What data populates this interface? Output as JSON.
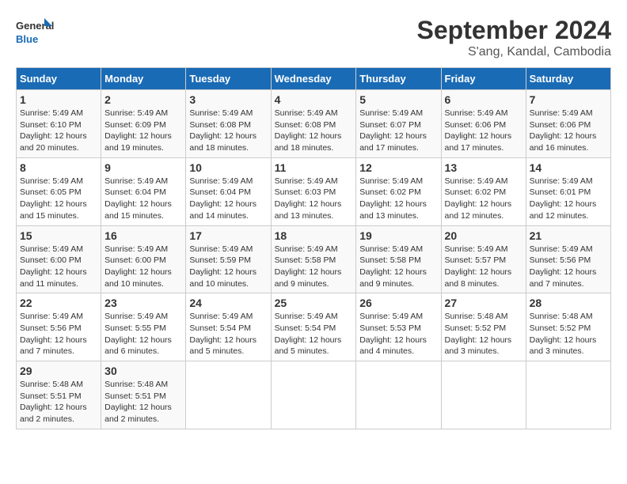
{
  "logo": {
    "text_general": "General",
    "text_blue": "Blue"
  },
  "header": {
    "month_year": "September 2024",
    "location": "S'ang, Kandal, Cambodia"
  },
  "weekdays": [
    "Sunday",
    "Monday",
    "Tuesday",
    "Wednesday",
    "Thursday",
    "Friday",
    "Saturday"
  ],
  "weeks": [
    [
      {
        "day": "1",
        "sunrise": "5:49 AM",
        "sunset": "6:10 PM",
        "daylight": "12 hours and 20 minutes."
      },
      {
        "day": "2",
        "sunrise": "5:49 AM",
        "sunset": "6:09 PM",
        "daylight": "12 hours and 19 minutes."
      },
      {
        "day": "3",
        "sunrise": "5:49 AM",
        "sunset": "6:08 PM",
        "daylight": "12 hours and 18 minutes."
      },
      {
        "day": "4",
        "sunrise": "5:49 AM",
        "sunset": "6:08 PM",
        "daylight": "12 hours and 18 minutes."
      },
      {
        "day": "5",
        "sunrise": "5:49 AM",
        "sunset": "6:07 PM",
        "daylight": "12 hours and 17 minutes."
      },
      {
        "day": "6",
        "sunrise": "5:49 AM",
        "sunset": "6:06 PM",
        "daylight": "12 hours and 17 minutes."
      },
      {
        "day": "7",
        "sunrise": "5:49 AM",
        "sunset": "6:06 PM",
        "daylight": "12 hours and 16 minutes."
      }
    ],
    [
      {
        "day": "8",
        "sunrise": "5:49 AM",
        "sunset": "6:05 PM",
        "daylight": "12 hours and 15 minutes."
      },
      {
        "day": "9",
        "sunrise": "5:49 AM",
        "sunset": "6:04 PM",
        "daylight": "12 hours and 15 minutes."
      },
      {
        "day": "10",
        "sunrise": "5:49 AM",
        "sunset": "6:04 PM",
        "daylight": "12 hours and 14 minutes."
      },
      {
        "day": "11",
        "sunrise": "5:49 AM",
        "sunset": "6:03 PM",
        "daylight": "12 hours and 13 minutes."
      },
      {
        "day": "12",
        "sunrise": "5:49 AM",
        "sunset": "6:02 PM",
        "daylight": "12 hours and 13 minutes."
      },
      {
        "day": "13",
        "sunrise": "5:49 AM",
        "sunset": "6:02 PM",
        "daylight": "12 hours and 12 minutes."
      },
      {
        "day": "14",
        "sunrise": "5:49 AM",
        "sunset": "6:01 PM",
        "daylight": "12 hours and 12 minutes."
      }
    ],
    [
      {
        "day": "15",
        "sunrise": "5:49 AM",
        "sunset": "6:00 PM",
        "daylight": "12 hours and 11 minutes."
      },
      {
        "day": "16",
        "sunrise": "5:49 AM",
        "sunset": "6:00 PM",
        "daylight": "12 hours and 10 minutes."
      },
      {
        "day": "17",
        "sunrise": "5:49 AM",
        "sunset": "5:59 PM",
        "daylight": "12 hours and 10 minutes."
      },
      {
        "day": "18",
        "sunrise": "5:49 AM",
        "sunset": "5:58 PM",
        "daylight": "12 hours and 9 minutes."
      },
      {
        "day": "19",
        "sunrise": "5:49 AM",
        "sunset": "5:58 PM",
        "daylight": "12 hours and 9 minutes."
      },
      {
        "day": "20",
        "sunrise": "5:49 AM",
        "sunset": "5:57 PM",
        "daylight": "12 hours and 8 minutes."
      },
      {
        "day": "21",
        "sunrise": "5:49 AM",
        "sunset": "5:56 PM",
        "daylight": "12 hours and 7 minutes."
      }
    ],
    [
      {
        "day": "22",
        "sunrise": "5:49 AM",
        "sunset": "5:56 PM",
        "daylight": "12 hours and 7 minutes."
      },
      {
        "day": "23",
        "sunrise": "5:49 AM",
        "sunset": "5:55 PM",
        "daylight": "12 hours and 6 minutes."
      },
      {
        "day": "24",
        "sunrise": "5:49 AM",
        "sunset": "5:54 PM",
        "daylight": "12 hours and 5 minutes."
      },
      {
        "day": "25",
        "sunrise": "5:49 AM",
        "sunset": "5:54 PM",
        "daylight": "12 hours and 5 minutes."
      },
      {
        "day": "26",
        "sunrise": "5:49 AM",
        "sunset": "5:53 PM",
        "daylight": "12 hours and 4 minutes."
      },
      {
        "day": "27",
        "sunrise": "5:48 AM",
        "sunset": "5:52 PM",
        "daylight": "12 hours and 3 minutes."
      },
      {
        "day": "28",
        "sunrise": "5:48 AM",
        "sunset": "5:52 PM",
        "daylight": "12 hours and 3 minutes."
      }
    ],
    [
      {
        "day": "29",
        "sunrise": "5:48 AM",
        "sunset": "5:51 PM",
        "daylight": "12 hours and 2 minutes."
      },
      {
        "day": "30",
        "sunrise": "5:48 AM",
        "sunset": "5:51 PM",
        "daylight": "12 hours and 2 minutes."
      },
      null,
      null,
      null,
      null,
      null
    ]
  ],
  "labels": {
    "sunrise": "Sunrise: ",
    "sunset": "Sunset: ",
    "daylight": "Daylight: "
  }
}
